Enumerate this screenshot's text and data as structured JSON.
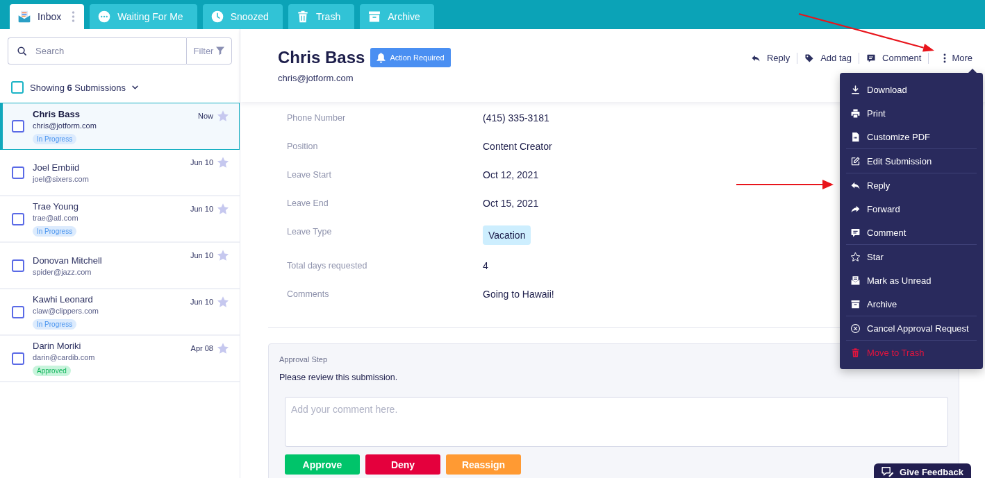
{
  "tabs": [
    {
      "label": "Inbox",
      "selected": true
    },
    {
      "label": "Waiting For Me",
      "selected": false
    },
    {
      "label": "Snoozed",
      "selected": false
    },
    {
      "label": "Trash",
      "selected": false
    },
    {
      "label": "Archive",
      "selected": false
    }
  ],
  "sidebar": {
    "search": {
      "placeholder": "Search"
    },
    "filter": "Filter",
    "select_all": {
      "label": "Showing **6** Submissions",
      "checked": false
    },
    "submissions": [
      {
        "name": "Chris Bass",
        "email": "chris@jotform.com",
        "date": "Now",
        "status": {
          "label": "In Progress",
          "kind": "in_progress"
        },
        "selected": true,
        "checked": false,
        "starred": false
      },
      {
        "name": "Joel Embiid",
        "email": "joel@sixers.com",
        "date": "Jun 10",
        "selected": false,
        "checked": false,
        "starred": false
      },
      {
        "name": "Trae Young",
        "email": "trae@atl.com",
        "date": "Jun 10",
        "status": {
          "label": "In Progress",
          "kind": "in_progress"
        },
        "selected": false,
        "checked": false,
        "starred": false
      },
      {
        "name": "Donovan Mitchell",
        "email": "spider@jazz.com",
        "date": "Jun 10",
        "selected": false,
        "checked": false,
        "starred": false
      },
      {
        "name": "Kawhi Leonard",
        "email": "claw@clippers.com",
        "date": "Jun 10",
        "status": {
          "label": "In Progress",
          "kind": "in_progress"
        },
        "selected": false,
        "checked": false,
        "starred": false
      },
      {
        "name": "Darin Moriki",
        "email": "darin@cardib.com",
        "date": "Apr 08",
        "status": {
          "label": "Approved",
          "kind": "approved"
        },
        "selected": false,
        "checked": false,
        "starred": false
      }
    ]
  },
  "submission": {
    "name": "Chris Bass",
    "badge": "Action Required",
    "email": "chris@jotform.com",
    "actions": [
      {
        "label": "Reply"
      },
      {
        "label": "Add tag"
      },
      {
        "label": "Comment"
      },
      {
        "label": "More"
      }
    ],
    "fields": [
      {
        "label": "Phone Number",
        "value": "(415) 335-3181",
        "kind": "text"
      },
      {
        "label": "Position",
        "value": "Content Creator",
        "kind": "text"
      },
      {
        "label": "Leave Start",
        "value": "Oct 12, 2021",
        "kind": "text"
      },
      {
        "label": "Leave End",
        "value": "Oct 15, 2021",
        "kind": "text"
      },
      {
        "label": "Leave Type",
        "value": "Vacation",
        "kind": "tag"
      },
      {
        "label": "Total days requested",
        "value": "4",
        "kind": "text"
      },
      {
        "label": "Comments",
        "value": "Going to Hawaii!",
        "kind": "text"
      }
    ],
    "approval": {
      "title": "Approval Step",
      "message": "Please review this submission.",
      "comment": {
        "placeholder": "Add your comment here."
      },
      "buttons": [
        {
          "label": "Approve",
          "kind": "approve"
        },
        {
          "label": "Deny",
          "kind": "deny"
        },
        {
          "label": "Reassign",
          "kind": "reassign"
        }
      ]
    }
  },
  "more_menu": {
    "groups": [
      [
        {
          "label": "Download",
          "kind": "action"
        },
        {
          "label": "Print",
          "kind": "action"
        },
        {
          "label": "Customize PDF",
          "kind": "action"
        }
      ],
      [
        {
          "label": "Edit Submission",
          "kind": "action"
        }
      ],
      [
        {
          "label": "Reply",
          "kind": "action"
        },
        {
          "label": "Forward",
          "kind": "action"
        },
        {
          "label": "Comment",
          "kind": "action"
        }
      ],
      [
        {
          "label": "Star",
          "kind": "action"
        },
        {
          "label": "Mark as Unread",
          "kind": "action"
        },
        {
          "label": "Archive",
          "kind": "action"
        }
      ],
      [
        {
          "label": "Cancel Approval Request",
          "kind": "action"
        }
      ],
      [
        {
          "label": "Move to Trash",
          "kind": "danger"
        }
      ]
    ]
  },
  "feedback_button": {
    "label": "Give Feedback"
  }
}
